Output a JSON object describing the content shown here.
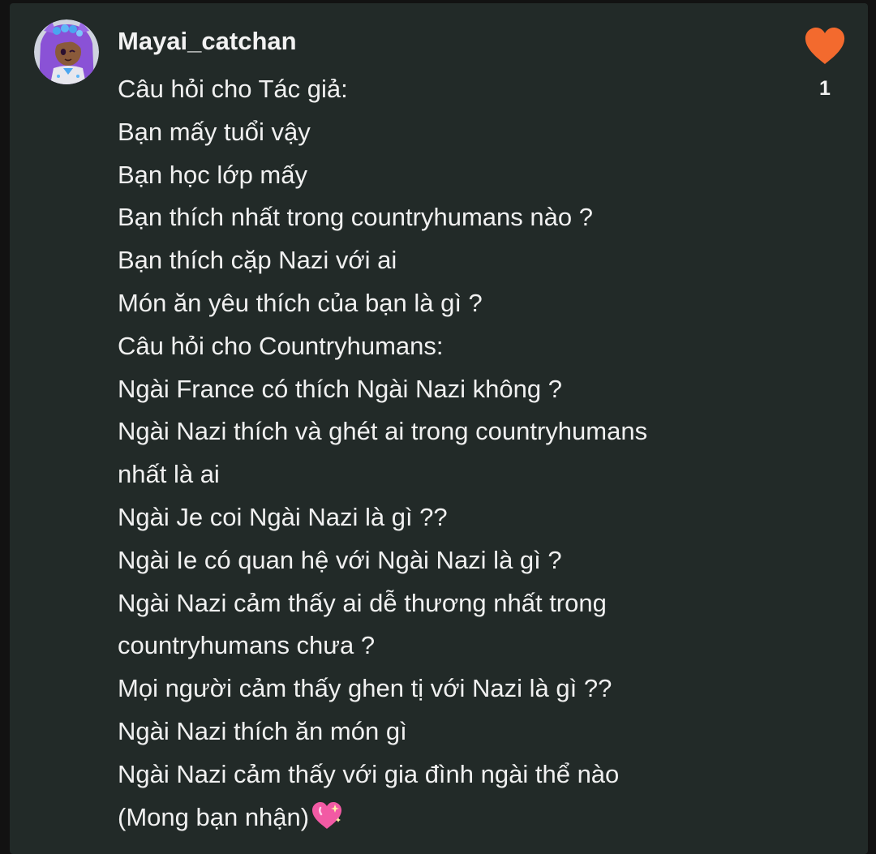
{
  "comment": {
    "username": "Mayai_catchan",
    "avatar_icon": "anime-avatar-icon",
    "like_icon": "heart-icon",
    "like_color": "#f36a2e",
    "like_count": "1",
    "lines": [
      "Câu hỏi cho Tác giả:",
      "Bạn mấy tuổi vậy",
      "Bạn học lớp mấy",
      "Bạn thích nhất trong countryhumans nào ?",
      "Bạn thích cặp Nazi với ai",
      "Món ăn yêu thích của bạn là gì ?",
      "Câu hỏi cho Countryhumans:",
      "Ngài France có thích Ngài Nazi không ?",
      "Ngài Nazi thích và ghét ai trong countryhumans",
      "nhất là ai",
      "Ngài Je coi Ngài Nazi là gì ??",
      "Ngài Ie có quan hệ với Ngài Nazi là gì ?",
      "Ngài Nazi cảm thấy ai dễ thương nhất trong",
      "countryhumans chưa ?",
      "Mọi người cảm thấy ghen tị với Nazi là gì ??",
      "Ngài Nazi thích ăn món gì",
      "Ngài Nazi cảm thấy với gia đình ngài thể nào",
      "(Mong bạn nhận)"
    ],
    "trailing_emoji": "sparkling-heart-icon"
  }
}
